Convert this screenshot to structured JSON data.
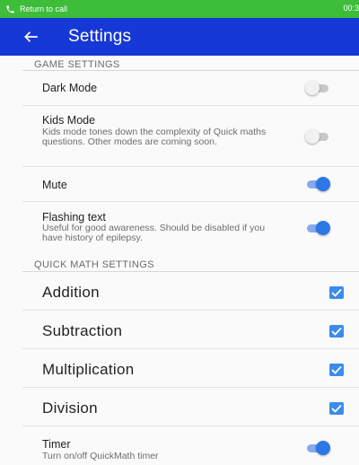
{
  "status_bar": {
    "call_text": "Return to call",
    "time": "00:3",
    "color": "#3dbd3a"
  },
  "app_bar": {
    "title": "Settings",
    "back_icon": "arrow-left-icon",
    "color": "#1638d6"
  },
  "game_settings": {
    "header": "GAME SETTINGS",
    "items": [
      {
        "label": "Dark Mode",
        "description": "",
        "enabled": false
      },
      {
        "label": "Kids Mode",
        "description": "Kids mode tones down the complexity of Quick maths questions. Other modes are coming soon.",
        "enabled": false
      },
      {
        "label": "Mute",
        "description": "",
        "enabled": true
      },
      {
        "label": "Flashing text",
        "description": "Useful for good awareness. Should be disabled if you have history of epilepsy.",
        "enabled": true
      }
    ]
  },
  "quick_math_settings": {
    "header": "QUICK MATH SETTINGS",
    "operations": [
      {
        "label": "Addition",
        "checked": true
      },
      {
        "label": "Subtraction",
        "checked": true
      },
      {
        "label": "Multiplication",
        "checked": true
      },
      {
        "label": "Division",
        "checked": true
      }
    ],
    "timer": {
      "label": "Timer",
      "description": "Turn on/off QuickMath timer",
      "enabled": true
    }
  },
  "colors": {
    "toggle_on": "#2b78e6",
    "checkbox": "#3b8ced"
  }
}
